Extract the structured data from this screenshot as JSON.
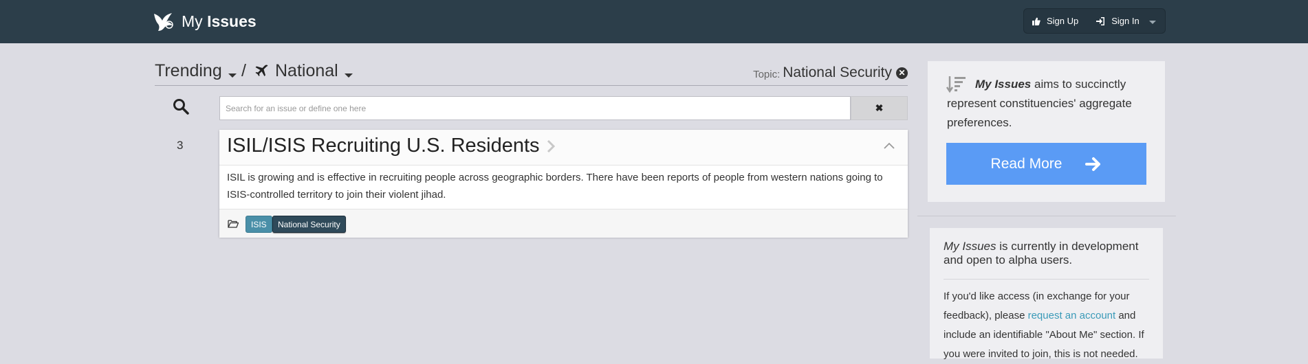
{
  "navbar": {
    "brand_prefix": "My",
    "brand_strong": "Issues",
    "logo_icon": "bird-logo-icon",
    "sign_up_label": "Sign Up",
    "sign_up_icon": "thumbs-up-icon",
    "sign_in_label": "Sign In",
    "sign_in_icon": "sign-in-icon",
    "background_color": "#2c3e4a"
  },
  "breadcrumb": {
    "trending_label": "Trending",
    "separator": "/",
    "national_label": "National",
    "national_icon": "plane-icon",
    "topic_label": "Topic:",
    "topic_value": "National Security"
  },
  "search": {
    "placeholder": "Search for an issue or define one here",
    "value": "",
    "clear_label": "✖"
  },
  "issues": [
    {
      "rank": "3",
      "title": "ISIL/ISIS Recruiting U.S. Residents",
      "description": "ISIL is growing and is effective in recruiting people across geographic borders. There have been reports of people from western nations going to ISIS-controlled territory to join their violent jihad.",
      "tags": [
        "ISIS",
        "National Security"
      ]
    }
  ],
  "sidebar": {
    "intro_em": "My Issues",
    "intro_rest": " aims to succinctly represent constituencies' aggregate preferences.",
    "read_more_label": "Read More",
    "read_more_color": "#5a9bf5",
    "status_em": "My Issues",
    "status_rest": " is currently in development and open to alpha users.",
    "access_text_1": "If you'd like access (in exchange for your feedback), please ",
    "access_link": "request an account",
    "access_text_2": " and include an identifiable \"About Me\" section. If you were invited to join, this is not needed."
  }
}
